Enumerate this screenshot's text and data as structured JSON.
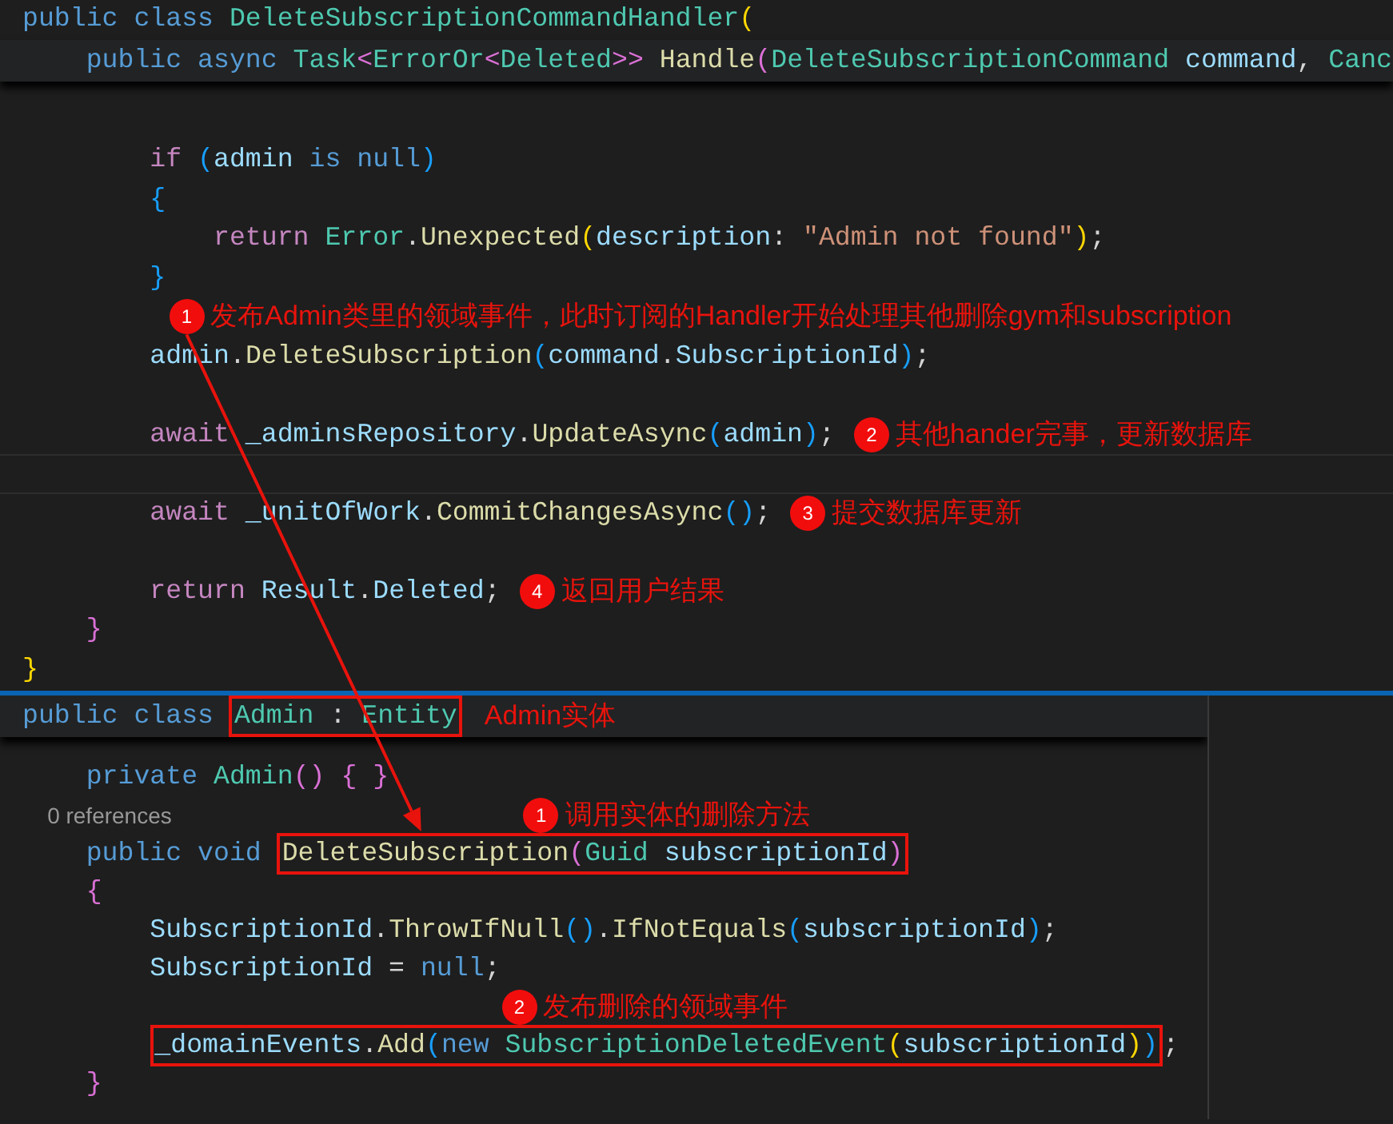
{
  "top_editor": {
    "lines": [
      {
        "kind": "code",
        "tokens": [
          {
            "text": "public class ",
            "kind": "kw"
          },
          {
            "text": "DeleteSubscriptionCommandHandler",
            "kind": "type"
          },
          {
            "text": "(",
            "kind": "br1"
          }
        ],
        "children": [
          {
            "kind": "sticky",
            "tokens": [
              {
                "text": "public async ",
                "kind": "kw"
              },
              {
                "text": "Task",
                "kind": "type"
              },
              {
                "text": "<",
                "kind": "br2"
              },
              {
                "text": "ErrorOr",
                "kind": "type"
              },
              {
                "text": "<",
                "kind": "br2"
              },
              {
                "text": "Deleted",
                "kind": "type"
              },
              {
                "text": ">>",
                "kind": "br2"
              },
              {
                "text": " Handle",
                "kind": "fn"
              },
              {
                "text": "(",
                "kind": "br2"
              },
              {
                "text": "DeleteSubscriptionCommand",
                "kind": "type"
              },
              {
                "text": " command",
                "kind": "var"
              },
              {
                "text": ", ",
                "kind": "punc"
              },
              {
                "text": "Canc",
                "kind": "type"
              }
            ],
            "children": [
              {
                "kind": "covered"
              },
              {
                "kind": "blank"
              },
              {
                "kind": "code",
                "tokens": [
                  {
                    "text": "if",
                    "kind": "ctl"
                  },
                  {
                    "text": " (",
                    "kind": "br3"
                  },
                  {
                    "text": "admin",
                    "kind": "var"
                  },
                  {
                    "text": " is null",
                    "kind": "kw"
                  },
                  {
                    "text": ")",
                    "kind": "br3"
                  }
                ]
              },
              {
                "kind": "code",
                "tokens": [
                  {
                    "text": "{",
                    "kind": "br3"
                  }
                ],
                "children": [
                  {
                    "kind": "code",
                    "tokens": [
                      {
                        "text": "return",
                        "kind": "ctl"
                      },
                      {
                        "text": " Error",
                        "kind": "type"
                      },
                      {
                        "text": ".",
                        "kind": "punc"
                      },
                      {
                        "text": "Unexpected",
                        "kind": "fn"
                      },
                      {
                        "text": "(",
                        "kind": "br1"
                      },
                      {
                        "text": "description",
                        "kind": "var"
                      },
                      {
                        "text": ": ",
                        "kind": "punc"
                      },
                      {
                        "text": "\"Admin not found\"",
                        "kind": "str"
                      },
                      {
                        "text": ")",
                        "kind": "br1"
                      },
                      {
                        "text": ";",
                        "kind": "punc"
                      }
                    ]
                  }
                ]
              },
              {
                "kind": "code",
                "tokens": [
                  {
                    "text": "}",
                    "kind": "br3"
                  }
                ]
              },
              {
                "kind": "blank",
                "note": {
                  "kind": "inline",
                  "number": "1",
                  "text": "发布Admin类里的领域事件，此时订阅的Handler开始处理其他删除gym和subscription",
                  "arrow": true
                }
              },
              {
                "kind": "code",
                "tokens": [
                  {
                    "text": "admin",
                    "kind": "var"
                  },
                  {
                    "text": ".",
                    "kind": "punc"
                  },
                  {
                    "text": "DeleteSubscription",
                    "kind": "fn"
                  },
                  {
                    "text": "(",
                    "kind": "br3"
                  },
                  {
                    "text": "command",
                    "kind": "var"
                  },
                  {
                    "text": ".",
                    "kind": "punc"
                  },
                  {
                    "text": "SubscriptionId",
                    "kind": "var"
                  },
                  {
                    "text": ")",
                    "kind": "br3"
                  },
                  {
                    "text": ";",
                    "kind": "punc"
                  }
                ]
              },
              {
                "kind": "blank"
              },
              {
                "kind": "code",
                "tokens": [
                  {
                    "text": "await",
                    "kind": "ctl"
                  },
                  {
                    "text": " _adminsRepository",
                    "kind": "var"
                  },
                  {
                    "text": ".",
                    "kind": "punc"
                  },
                  {
                    "text": "UpdateAsync",
                    "kind": "fn"
                  },
                  {
                    "text": "(",
                    "kind": "br3"
                  },
                  {
                    "text": "admin",
                    "kind": "var"
                  },
                  {
                    "text": ")",
                    "kind": "br3"
                  },
                  {
                    "text": ";",
                    "kind": "punc"
                  }
                ],
                "note": {
                  "kind": "inline",
                  "number": "2",
                  "text": "其他hander完事，更新数据库"
                }
              },
              {
                "kind": "current"
              },
              {
                "kind": "code",
                "tokens": [
                  {
                    "text": "await",
                    "kind": "ctl"
                  },
                  {
                    "text": " _unitOfWork",
                    "kind": "var"
                  },
                  {
                    "text": ".",
                    "kind": "punc"
                  },
                  {
                    "text": "CommitChangesAsync",
                    "kind": "fn"
                  },
                  {
                    "text": "()",
                    "kind": "br3"
                  },
                  {
                    "text": ";",
                    "kind": "punc"
                  }
                ],
                "note": {
                  "kind": "inline",
                  "number": "3",
                  "text": "提交数据库更新"
                }
              },
              {
                "kind": "blank"
              },
              {
                "kind": "code",
                "tokens": [
                  {
                    "text": "return",
                    "kind": "ctl"
                  },
                  {
                    "text": " Result",
                    "kind": "var"
                  },
                  {
                    "text": ".",
                    "kind": "punc"
                  },
                  {
                    "text": "Deleted",
                    "kind": "var"
                  },
                  {
                    "text": ";",
                    "kind": "punc"
                  }
                ],
                "note": {
                  "kind": "inline",
                  "number": "4",
                  "text": "返回用户结果"
                }
              }
            ]
          },
          {
            "kind": "code",
            "tokens": [
              {
                "text": "}",
                "kind": "br2"
              }
            ]
          }
        ]
      },
      {
        "kind": "code",
        "tokens": [
          {
            "text": "}",
            "kind": "br1"
          }
        ]
      }
    ]
  },
  "bottom_editor": {
    "lines": [
      {
        "kind": "sticky",
        "tokens": [
          {
            "text": "public class ",
            "kind": "kw"
          },
          {
            "kind": "box",
            "tokens": [
              {
                "text": "Admin",
                "kind": "type"
              },
              {
                "text": " : ",
                "kind": "punc"
              },
              {
                "text": "Entity",
                "kind": "type"
              }
            ]
          }
        ],
        "note": {
          "kind": "inline",
          "text": "Admin实体"
        },
        "children": [
          {
            "kind": "covered"
          },
          {
            "kind": "code",
            "tokens": [
              {
                "text": "private ",
                "kind": "kw"
              },
              {
                "text": "Admin",
                "kind": "type"
              },
              {
                "text": "()",
                "kind": "br2"
              },
              {
                "text": " { }",
                "kind": "br2"
              }
            ]
          },
          {
            "kind": "codelens",
            "tokens": [
              {
                "text": "0 references",
                "kind": "lens"
              }
            ],
            "note": {
              "kind": "offset",
              "number": "1",
              "text": "调用实体的删除方法"
            }
          },
          {
            "kind": "code",
            "arrow_target": true,
            "tokens": [
              {
                "text": "public void ",
                "kind": "kw"
              },
              {
                "kind": "box",
                "tokens": [
                  {
                    "text": "DeleteSubscription",
                    "kind": "fn"
                  },
                  {
                    "text": "(",
                    "kind": "br2"
                  },
                  {
                    "text": "Guid",
                    "kind": "type"
                  },
                  {
                    "text": " subscriptionId",
                    "kind": "var"
                  },
                  {
                    "text": ")",
                    "kind": "br2"
                  }
                ]
              }
            ]
          },
          {
            "kind": "code",
            "tokens": [
              {
                "text": "{",
                "kind": "br2"
              }
            ],
            "children": [
              {
                "kind": "code",
                "tokens": [
                  {
                    "text": "SubscriptionId",
                    "kind": "var"
                  },
                  {
                    "text": ".",
                    "kind": "punc"
                  },
                  {
                    "text": "ThrowIfNull",
                    "kind": "fn"
                  },
                  {
                    "text": "()",
                    "kind": "br3"
                  },
                  {
                    "text": ".",
                    "kind": "punc"
                  },
                  {
                    "text": "IfNotEquals",
                    "kind": "fn"
                  },
                  {
                    "text": "(",
                    "kind": "br3"
                  },
                  {
                    "text": "subscriptionId",
                    "kind": "var"
                  },
                  {
                    "text": ")",
                    "kind": "br3"
                  },
                  {
                    "text": ";",
                    "kind": "punc"
                  }
                ]
              },
              {
                "kind": "code",
                "tokens": [
                  {
                    "text": "SubscriptionId",
                    "kind": "var"
                  },
                  {
                    "text": " = ",
                    "kind": "punc"
                  },
                  {
                    "text": "null",
                    "kind": "kw"
                  },
                  {
                    "text": ";",
                    "kind": "punc"
                  }
                ]
              },
              {
                "kind": "blank",
                "note": {
                  "kind": "offset",
                  "number": "2",
                  "text": "发布删除的领域事件"
                }
              },
              {
                "kind": "code",
                "tokens": [
                  {
                    "kind": "box",
                    "tokens": [
                      {
                        "text": "_domainEvents",
                        "kind": "var"
                      },
                      {
                        "text": ".",
                        "kind": "punc"
                      },
                      {
                        "text": "Add",
                        "kind": "fn"
                      },
                      {
                        "text": "(",
                        "kind": "br3"
                      },
                      {
                        "text": "new",
                        "kind": "kw"
                      },
                      {
                        "text": " SubscriptionDeletedEvent",
                        "kind": "type"
                      },
                      {
                        "text": "(",
                        "kind": "br1"
                      },
                      {
                        "text": "subscriptionId",
                        "kind": "var"
                      },
                      {
                        "text": ")",
                        "kind": "br1"
                      },
                      {
                        "text": ")",
                        "kind": "br3"
                      }
                    ]
                  },
                  {
                    "text": ";",
                    "kind": "punc"
                  }
                ]
              }
            ]
          },
          {
            "kind": "code",
            "tokens": [
              {
                "text": "}",
                "kind": "br2"
              }
            ]
          }
        ]
      }
    ]
  }
}
